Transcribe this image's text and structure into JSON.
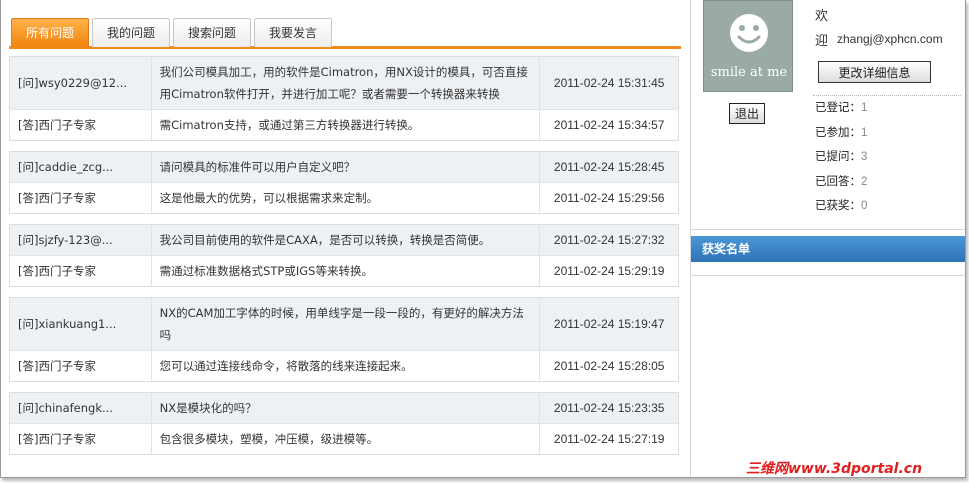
{
  "tabs": [
    {
      "label": "所有问题",
      "active": true
    },
    {
      "label": "我的问题",
      "active": false
    },
    {
      "label": "搜索问题",
      "active": false
    },
    {
      "label": "我要发言",
      "active": false
    }
  ],
  "qa": [
    {
      "q": {
        "user": "[问]wsy0229@12...",
        "text": "我们公司模具加工，用的软件是Cimatron，用NX设计的模具，可否直接用Cimatron软件打开，并进行加工呢？或者需要一个转换器来转换",
        "time": "2011-02-24 15:31:45"
      },
      "a": {
        "user": "[答]西门子专家",
        "text": "需Cimatron支持，或通过第三方转换器进行转换。",
        "time": "2011-02-24 15:34:57"
      }
    },
    {
      "q": {
        "user": "[问]caddie_zcg...",
        "text": "请问模具的标准件可以用户自定义吧？",
        "time": "2011-02-24 15:28:45"
      },
      "a": {
        "user": "[答]西门子专家",
        "text": "这是他最大的优势，可以根据需求来定制。",
        "time": "2011-02-24 15:29:56"
      }
    },
    {
      "q": {
        "user": "[问]sjzfy-123@...",
        "text": "我公司目前使用的软件是CAXA，是否可以转换，转换是否简便。",
        "time": "2011-02-24 15:27:32"
      },
      "a": {
        "user": "[答]西门子专家",
        "text": "需通过标准数据格式STP或IGS等来转换。",
        "time": "2011-02-24 15:29:19"
      }
    },
    {
      "q": {
        "user": "[问]xiankuang1...",
        "text": "NX的CAM加工字体的时候，用单线字是一段一段的，有更好的解决方法吗",
        "time": "2011-02-24 15:19:47"
      },
      "a": {
        "user": "[答]西门子专家",
        "text": "您可以通过连接线命令，将散落的线来连接起来。",
        "time": "2011-02-24 15:28:05"
      }
    },
    {
      "q": {
        "user": "[问]chinafengk...",
        "text": "NX是模块化的吗？",
        "time": "2011-02-24 15:23:35"
      },
      "a": {
        "user": "[答]西门子专家",
        "text": "包含很多模块，塑模，冲压模，级进模等。",
        "time": "2011-02-24 15:27:19"
      }
    }
  ],
  "profile": {
    "avatar_caption": "smile at me",
    "welcome_line1": "欢",
    "welcome_line2": "迎",
    "email": "zhangj@xphcn.com",
    "detail_button": "更改详细信息",
    "logout_button": "退出",
    "stats": [
      {
        "label": "已登记：",
        "value": "1"
      },
      {
        "label": "已参加：",
        "value": "1"
      },
      {
        "label": "已提问：",
        "value": "3"
      },
      {
        "label": "已回答：",
        "value": "2"
      },
      {
        "label": "已获奖：",
        "value": "0"
      }
    ]
  },
  "award_title": "获奖名单",
  "watermark": "三维网www.3dportal.cn",
  "colors": {
    "tab_active": "#f08a1c",
    "award_header": "#2f73b5",
    "question_row_bg": "#eef1f4"
  }
}
